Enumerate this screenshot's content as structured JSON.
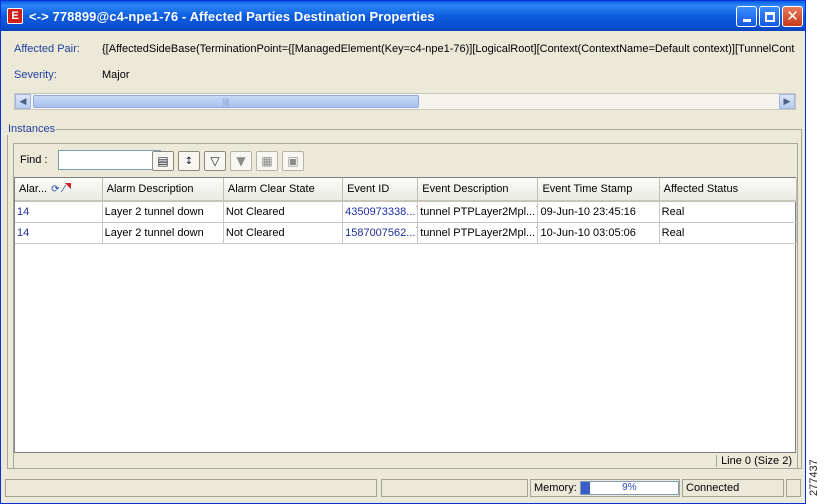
{
  "window": {
    "title": "<-> 778899@c4-npe1-76 - Affected Parties Destination Properties",
    "app_icon": "E"
  },
  "properties": {
    "affected_pair_label": "Affected Pair:",
    "affected_pair_value": "{[AffectedSideBase(TerminationPoint={[ManagedElement(Key=c4-npe1-76)][LogicalRoot][Context(ContextName=Default context)][TunnelCont",
    "severity_label": "Severity:",
    "severity_value": "Major"
  },
  "instances": {
    "legend": "Instances",
    "find_label": "Find :",
    "find_value": "",
    "columns": [
      "Alar...",
      "Alarm Description",
      "Alarm Clear State",
      "Event ID",
      "Event Description",
      "Event Time Stamp",
      "Affected Status"
    ],
    "rows": [
      [
        "14",
        "Layer 2 tunnel down",
        "Not Cleared",
        "4350973338...",
        "tunnel PTPLayer2Mpl...",
        "09-Jun-10 23:45:16",
        "Real"
      ],
      [
        "14",
        "Layer 2 tunnel down",
        "Not Cleared",
        "1587007562...",
        "tunnel PTPLayer2Mpl...",
        "10-Jun-10 03:05:06",
        "Real"
      ]
    ],
    "line_status": "Line 0 (Size 2)"
  },
  "statusbar": {
    "memory_label": "Memory:",
    "memory_percent": "9%",
    "memory_fraction": 0.09,
    "connection": "Connected"
  },
  "figure_number": "277437"
}
